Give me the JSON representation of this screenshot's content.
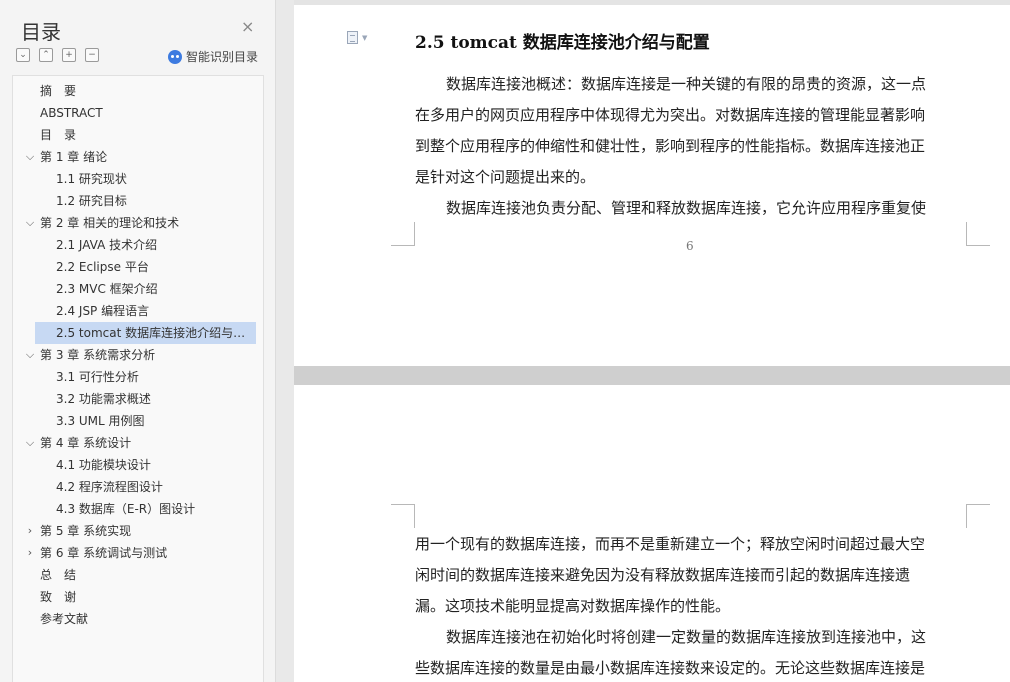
{
  "sidebar": {
    "title": "目录",
    "close_icon": "×",
    "tools": [
      {
        "name": "collapse-all-icon",
        "glyph": "⌄"
      },
      {
        "name": "expand-all-icon",
        "glyph": "⌃"
      },
      {
        "name": "add-heading-icon",
        "glyph": "+"
      },
      {
        "name": "remove-heading-icon",
        "glyph": "−"
      }
    ],
    "smart_label": "智能识别目录",
    "toc": [
      {
        "label": "摘　要",
        "level": 0,
        "chevron": ""
      },
      {
        "label": "ABSTRACT",
        "level": 0,
        "chevron": ""
      },
      {
        "label": "目　录",
        "level": 0,
        "chevron": ""
      },
      {
        "label": "第 1 章  绪论",
        "level": 0,
        "chevron": "expanded"
      },
      {
        "label": "1.1 研究现状",
        "level": 1,
        "chevron": ""
      },
      {
        "label": "1.2 研究目标",
        "level": 1,
        "chevron": ""
      },
      {
        "label": "第 2 章  相关的理论和技术",
        "level": 0,
        "chevron": "expanded"
      },
      {
        "label": "2.1 JAVA 技术介绍",
        "level": 1,
        "chevron": ""
      },
      {
        "label": "2.2 Eclipse 平台",
        "level": 1,
        "chevron": ""
      },
      {
        "label": "2.3 MVC 框架介绍",
        "level": 1,
        "chevron": ""
      },
      {
        "label": "2.4 JSP 编程语言",
        "level": 1,
        "chevron": ""
      },
      {
        "label": "2.5 tomcat  数据库连接池介绍与配置",
        "level": 1,
        "chevron": "",
        "selected": true
      },
      {
        "label": "第 3 章  系统需求分析",
        "level": 0,
        "chevron": "expanded"
      },
      {
        "label": "3.1  可行性分析",
        "level": 1,
        "chevron": ""
      },
      {
        "label": "3.2  功能需求概述",
        "level": 1,
        "chevron": ""
      },
      {
        "label": "3.3 UML 用例图",
        "level": 1,
        "chevron": ""
      },
      {
        "label": "第 4 章  系统设计",
        "level": 0,
        "chevron": "expanded"
      },
      {
        "label": "4.1 功能模块设计",
        "level": 1,
        "chevron": ""
      },
      {
        "label": "4.2  程序流程图设计",
        "level": 1,
        "chevron": ""
      },
      {
        "label": "4.3  数据库（E-R）图设计",
        "level": 1,
        "chevron": ""
      },
      {
        "label": "第 5 章  系统实现",
        "level": 0,
        "chevron": "collapsed"
      },
      {
        "label": "第 6 章  系统调试与测试",
        "level": 0,
        "chevron": "collapsed"
      },
      {
        "label": "总　结",
        "level": 0,
        "chevron": ""
      },
      {
        "label": "致　谢",
        "level": 0,
        "chevron": ""
      },
      {
        "label": "参考文献",
        "level": 0,
        "chevron": ""
      }
    ]
  },
  "document": {
    "heading": "2.5 tomcat  数据库连接池介绍与配置",
    "page1_lines": [
      {
        "text": "数据库连接池概述：数据库连接是一种关键的有限的昂贵的资源，这一点",
        "indent": true
      },
      {
        "text": "在多用户的网页应用程序中体现得尤为突出。对数据库连接的管理能显著影响",
        "indent": false
      },
      {
        "text": "到整个应用程序的伸缩性和健壮性，影响到程序的性能指标。数据库连接池正",
        "indent": false
      },
      {
        "text": "是针对这个问题提出来的。",
        "indent": false
      },
      {
        "text": "数据库连接池负责分配、管理和释放数据库连接，它允许应用程序重复使",
        "indent": true
      }
    ],
    "page_number": "6",
    "page2_lines": [
      {
        "text": "用一个现有的数据库连接，而再不是重新建立一个；释放空闲时间超过最大空",
        "indent": false
      },
      {
        "text": "闲时间的数据库连接来避免因为没有释放数据库连接而引起的数据库连接遗",
        "indent": false
      },
      {
        "text": "漏。这项技术能明显提高对数据库操作的性能。",
        "indent": false
      },
      {
        "text": "数据库连接池在初始化时将创建一定数量的数据库连接放到连接池中，这",
        "indent": true
      },
      {
        "text": "些数据库连接的数量是由最小数据库连接数来设定的。无论这些数据库连接是",
        "indent": false
      }
    ]
  }
}
